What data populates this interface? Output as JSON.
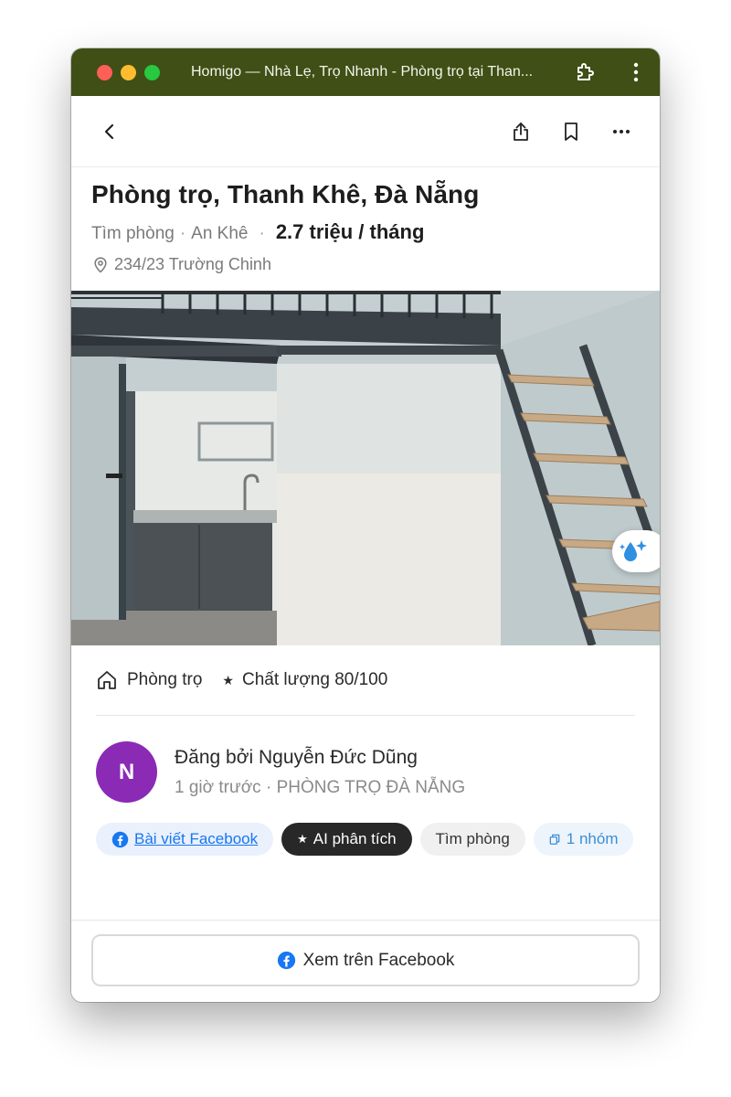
{
  "window": {
    "title": "Homigo — Nhà Lẹ, Trọ Nhanh - Phòng trọ tại Than..."
  },
  "listing": {
    "title": "Phòng trọ, Thanh Khê, Đà Nẵng",
    "category": "Tìm phòng",
    "area": "An Khê",
    "price": "2.7 triệu / tháng",
    "address": "234/23 Trường Chinh"
  },
  "tags": {
    "type": "Phòng trọ",
    "quality": "Chất lượng 80/100"
  },
  "poster": {
    "avatar_letter": "N",
    "name": "Đăng bởi Nguyễn Đức Dũng",
    "time": "1 giờ trước",
    "group": "PHÒNG TRỌ ĐÀ NẴNG"
  },
  "chips": {
    "facebook_post": "Bài viết Facebook",
    "ai_analysis": "AI phân tích",
    "find_room": "Tìm phòng",
    "groups": "1 nhóm"
  },
  "footer": {
    "view_on_facebook": "Xem trên Facebook"
  },
  "icons": {
    "back": "chevron-left-icon",
    "share": "share-icon",
    "bookmark": "bookmark-icon",
    "more": "more-horizontal-icon",
    "location": "map-pin-icon",
    "home": "home-icon",
    "facebook": "facebook-icon",
    "sparkle": "sparkle-droplet-icon"
  },
  "colors": {
    "titlebar": "#3f4f15",
    "avatar": "#8a2ab5",
    "facebook": "#1877f2",
    "ai_chip": "#282828"
  }
}
